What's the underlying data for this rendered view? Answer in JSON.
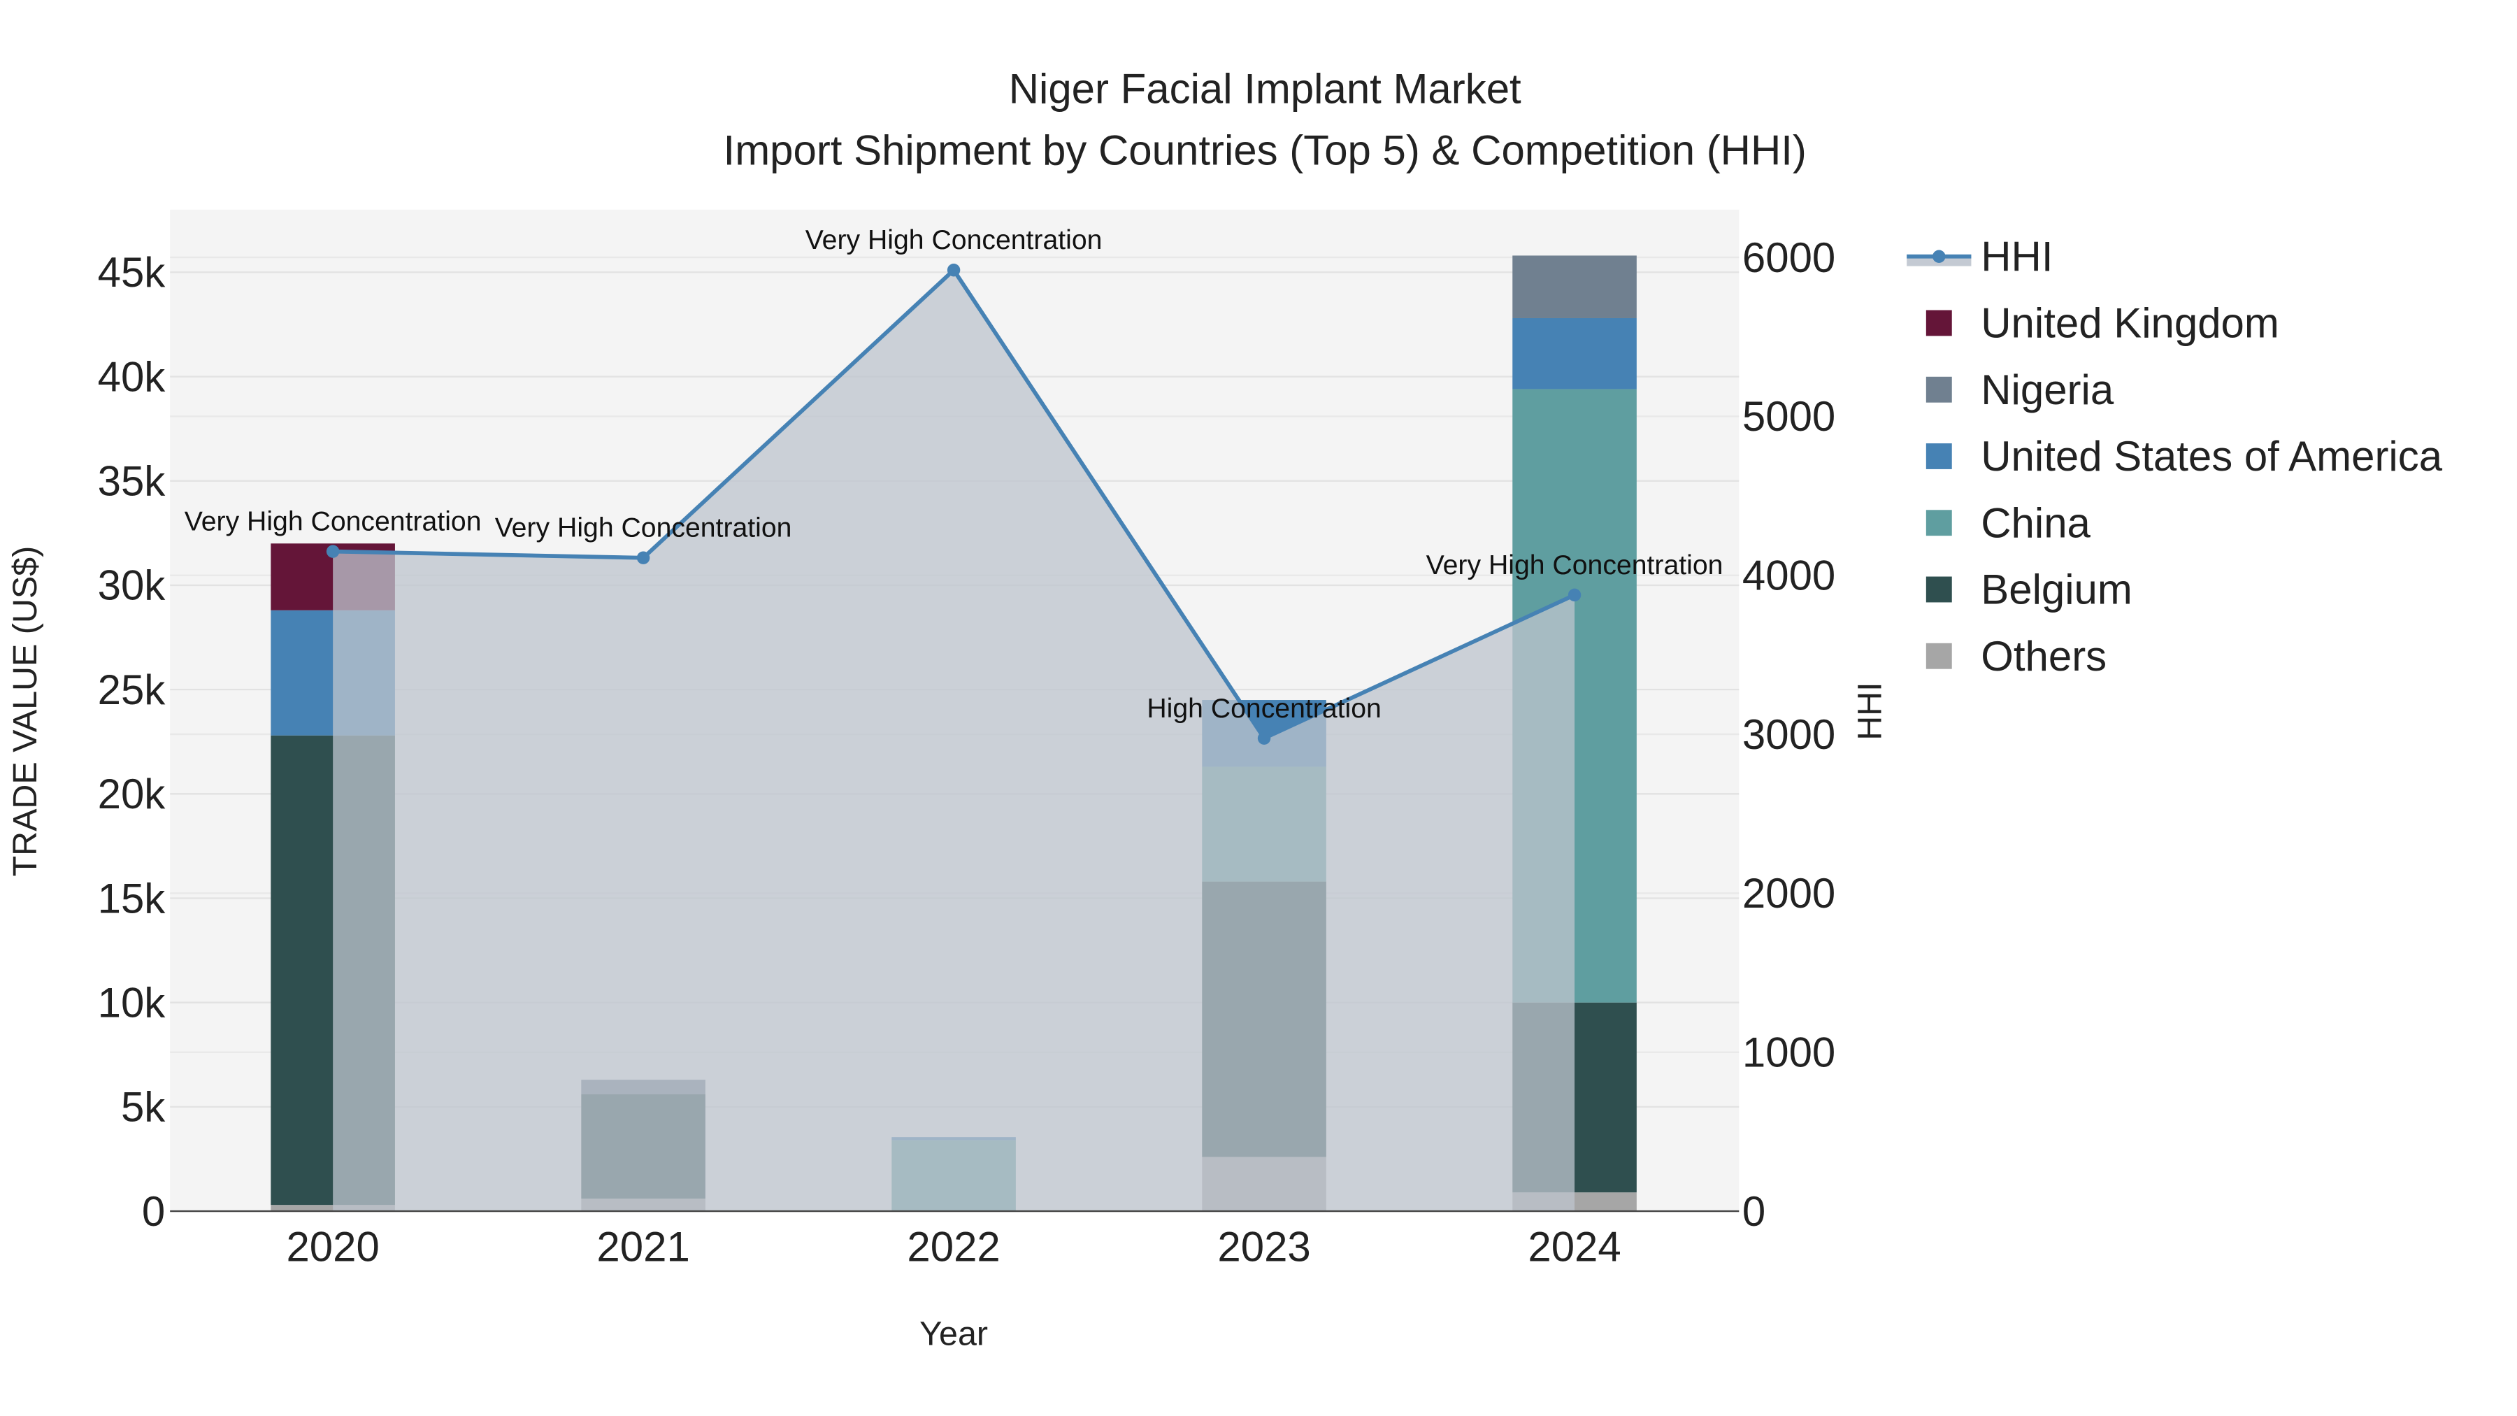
{
  "chart_data": {
    "type": "bar",
    "title": "Niger Facial Implant Market",
    "subtitle": "Import Shipment by Countries (Top 5) & Competition (HHI)",
    "xlabel": "Year",
    "ylabel": "TRADE VALUE (US$)",
    "y2label": "HHI",
    "categories": [
      "2020",
      "2021",
      "2022",
      "2023",
      "2024"
    ],
    "ylim": [
      0,
      48000
    ],
    "y2lim": [
      0,
      6300
    ],
    "yticks": [
      "0",
      "5k",
      "10k",
      "15k",
      "20k",
      "25k",
      "30k",
      "35k",
      "40k",
      "45k"
    ],
    "y2ticks": [
      "0",
      "1000",
      "2000",
      "3000",
      "4000",
      "5000",
      "6000"
    ],
    "barmode": "stack",
    "series": [
      {
        "name": "Others",
        "color": "#a6a6a6",
        "values": [
          300,
          600,
          0,
          2600,
          900
        ]
      },
      {
        "name": "Belgium",
        "color": "#2f4f4f",
        "values": [
          22500,
          5000,
          0,
          13200,
          9100
        ]
      },
      {
        "name": "China",
        "color": "#5f9ea0",
        "values": [
          0,
          0,
          3400,
          5500,
          29400
        ]
      },
      {
        "name": "United States of America",
        "color": "#4682b4",
        "values": [
          6000,
          0,
          150,
          3200,
          3400
        ]
      },
      {
        "name": "Nigeria",
        "color": "#708090",
        "values": [
          0,
          700,
          0,
          0,
          3000
        ]
      },
      {
        "name": "United Kingdom",
        "color": "#641538",
        "values": [
          3200,
          0,
          0,
          0,
          0
        ]
      }
    ],
    "line": {
      "name": "HHI",
      "color": "#4682b4",
      "axis": "right",
      "values": [
        4150,
        4110,
        5920,
        2975,
        3876
      ],
      "labels": [
        "Very High Concentration",
        "Very High Concentration",
        "Very High Concentration",
        "High Concentration",
        "Very High Concentration"
      ]
    },
    "legend": {
      "placement": "top-right-outside",
      "entries": [
        "HHI",
        "United Kingdom",
        "Nigeria",
        "United States of America",
        "China",
        "Belgium",
        "Others"
      ]
    },
    "grid": true
  }
}
